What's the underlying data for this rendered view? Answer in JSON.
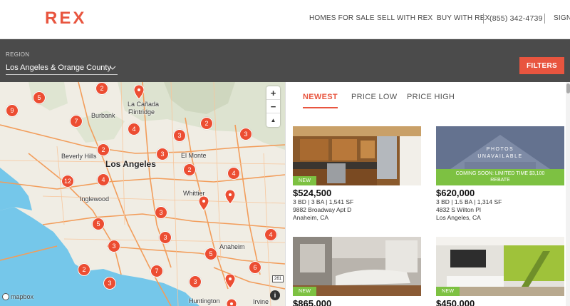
{
  "brand": {
    "logo_text": "REX",
    "accent": "#e8553f",
    "new_badge_color": "#7dc142"
  },
  "nav": {
    "homes_for_sale": "HOMES FOR SALE",
    "sell_with_rex": "SELL WITH REX",
    "buy_with_rex": "BUY WITH REX",
    "phone": "(855) 342-4739",
    "sign_in": "SIGN IN"
  },
  "region": {
    "label": "REGION",
    "value": "Los Angeles & Orange County"
  },
  "filters_label": "FILTERS",
  "map": {
    "places": {
      "la_canada": "La Cañada",
      "flintridge": "Flintridge",
      "burbank": "Burbank",
      "beverly_hills": "Beverly Hills",
      "los_angeles": "Los Angeles",
      "el_monte": "El Monte",
      "inglewood": "Inglewood",
      "whittier": "Whittier",
      "anaheim": "Anaheim",
      "huntington": "Huntington",
      "irvine": "Irvine"
    },
    "clusters": [
      "5",
      "2",
      "9",
      "7",
      "4",
      "2",
      "3",
      "3",
      "2",
      "3",
      "2",
      "12",
      "4",
      "4",
      "3",
      "5",
      "3",
      "3",
      "4",
      "5",
      "2",
      "7",
      "3",
      "6",
      "3"
    ],
    "zoom_in": "+",
    "zoom_out": "−",
    "compass": "▲",
    "attribution": "mapbox",
    "info": "i",
    "highway_shield": "261"
  },
  "sort_tabs": {
    "newest": "NEWEST",
    "price_low": "PRICE LOW",
    "price_high": "PRICE HIGH"
  },
  "listings": [
    {
      "badge": "NEW",
      "price": "$524,500",
      "specs": "3 BD | 3 BA | 1,541 SF",
      "address": "9882 Broadway Apt D",
      "city": "Anaheim, CA"
    },
    {
      "photos": "PHOTOS",
      "unavailable": "UNAVAILABLE",
      "rebate": "COMING SOON: LIMITED TIME $3,100",
      "rebate2": "REBATE",
      "price": "$620,000",
      "specs": "3 BD | 1.5 BA | 1,314 SF",
      "address": "4832 S Wilton Pl",
      "city": "Los Angeles, CA"
    },
    {
      "badge": "NEW",
      "price": "$865,000"
    },
    {
      "badge": "NEW",
      "price": "$450,000"
    }
  ]
}
